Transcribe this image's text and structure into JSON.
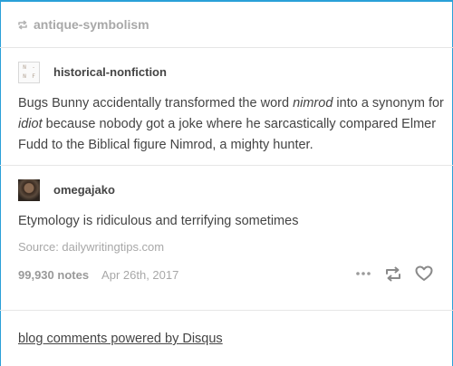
{
  "reblog": {
    "source_blog": "antique-symbolism",
    "icon": "reblog-icon"
  },
  "posts": [
    {
      "username": "historical-nonfiction",
      "avatar": "avatar-monogram",
      "avatar_letters": [
        "N",
        "-",
        "N",
        "F"
      ],
      "text_parts": [
        "Bugs Bunny accidentally transformed the word ",
        "nimrod",
        " into a synonym for ",
        "idiot",
        " because nobody got a joke where he sarcastically compared Elmer Fudd to the Biblical figure Nimrod, a mighty hunter."
      ]
    },
    {
      "username": "omegajako",
      "avatar": "avatar-photo",
      "text": "Etymology is ridiculous and terrifying sometimes"
    }
  ],
  "source": "Source: dailywritingtips.com",
  "footer": {
    "notes": "99,930 notes",
    "date": "Apr 26th, 2017",
    "actions": [
      "more-icon",
      "reblog-icon",
      "heart-icon"
    ]
  },
  "disqus_link": "blog comments powered by Disqus",
  "colors": {
    "accent_border": "#2aa0d8",
    "text": "#444444",
    "muted": "#a8a8a8",
    "divider": "#e6e6e6"
  }
}
